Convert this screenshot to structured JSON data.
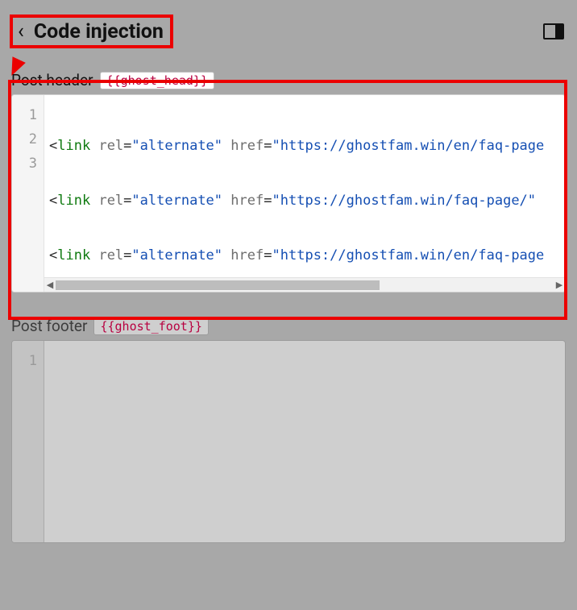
{
  "topbar": {
    "title": "Code injection"
  },
  "sections": {
    "header": {
      "label": "Post header",
      "tag": "{{ghost_head}}"
    },
    "footer": {
      "label": "Post footer",
      "tag": "{{ghost_foot}}"
    }
  },
  "header_code": {
    "line_numbers": [
      "1",
      "2",
      "3"
    ],
    "lines": [
      {
        "tag": "link",
        "attr1": "rel",
        "val1": "alternate",
        "attr2": "href",
        "val2": "https://ghostfam.win/en/faq-page"
      },
      {
        "tag": "link",
        "attr1": "rel",
        "val1": "alternate",
        "attr2": "href",
        "val2": "https://ghostfam.win/faq-page/"
      },
      {
        "tag": "link",
        "attr1": "rel",
        "val1": "alternate",
        "attr2": "href",
        "val2": "https://ghostfam.win/en/faq-page"
      }
    ]
  },
  "footer_code": {
    "line_numbers": [
      "1"
    ]
  }
}
